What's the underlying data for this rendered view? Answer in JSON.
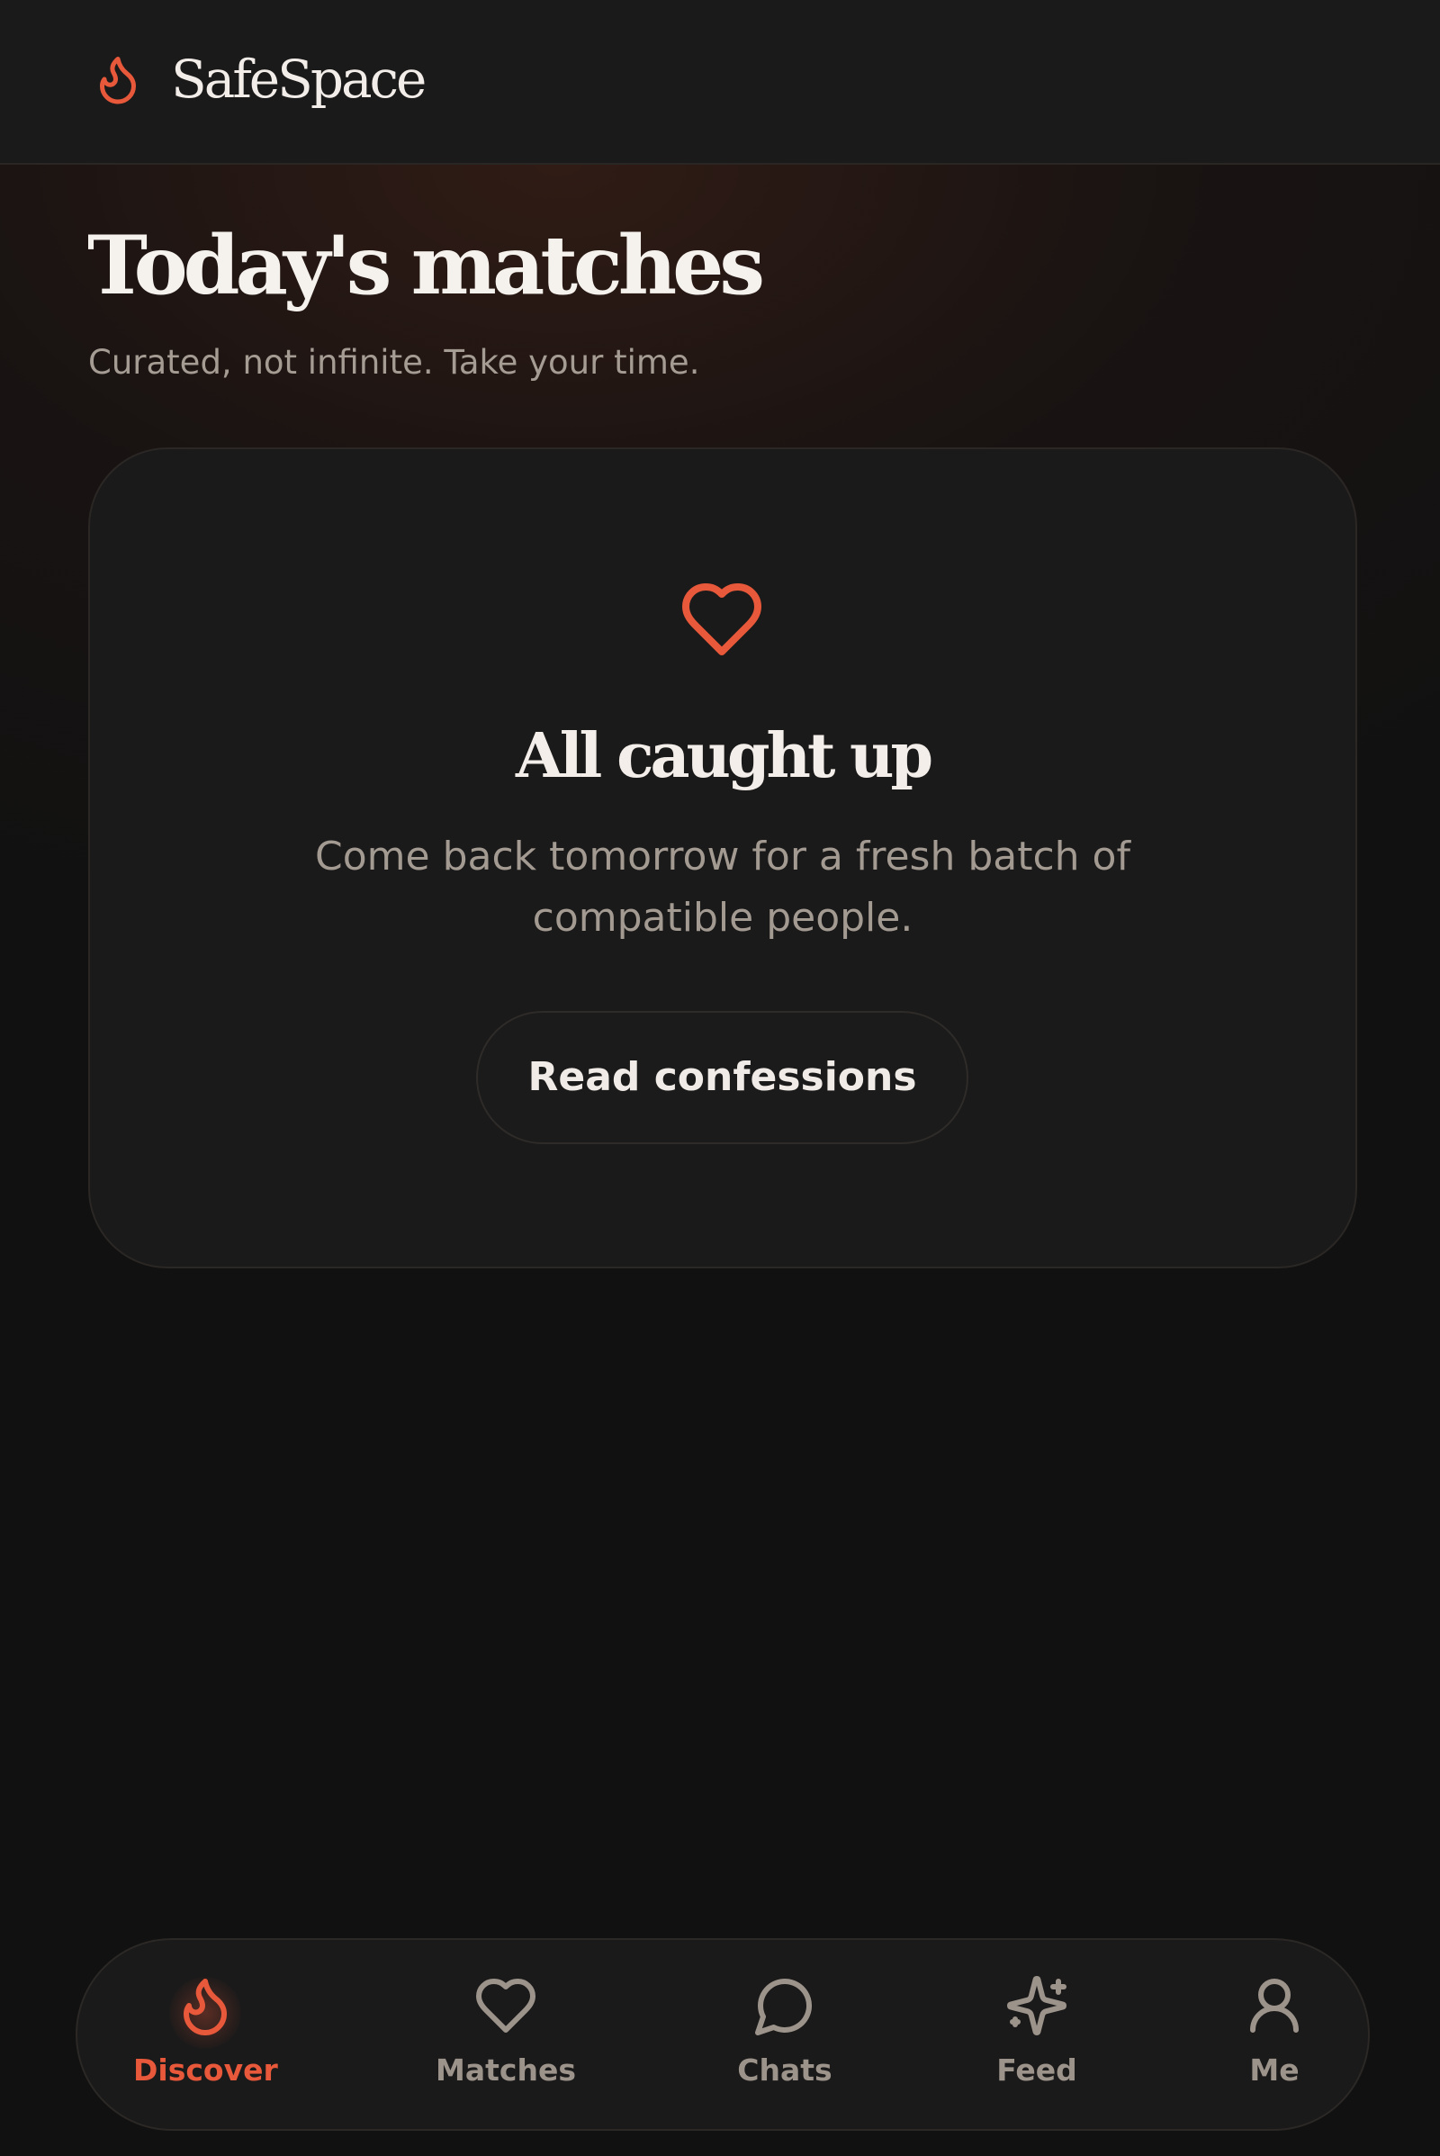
{
  "header": {
    "brand_name": "SafeSpace",
    "brand_icon": "flame-icon"
  },
  "page": {
    "title": "Today's matches",
    "subtitle": "Curated, not infinite. Take your time."
  },
  "empty_state": {
    "icon": "heart-icon",
    "title": "All caught up",
    "message": "Come back tomorrow for a fresh batch of compatible people.",
    "button_label": "Read confessions"
  },
  "nav": {
    "items": [
      {
        "label": "Discover",
        "icon": "flame-icon",
        "active": true
      },
      {
        "label": "Matches",
        "icon": "heart-icon",
        "active": false
      },
      {
        "label": "Chats",
        "icon": "chat-bubble-icon",
        "active": false
      },
      {
        "label": "Feed",
        "icon": "sparkles-icon",
        "active": false
      },
      {
        "label": "Me",
        "icon": "user-icon",
        "active": false
      }
    ]
  },
  "colors": {
    "accent": "#e8583a",
    "background": "#111111",
    "surface": "#1b1a1a",
    "text_primary": "#f3eee9",
    "text_muted": "#a39a92",
    "nav_inactive": "#9c938b"
  }
}
